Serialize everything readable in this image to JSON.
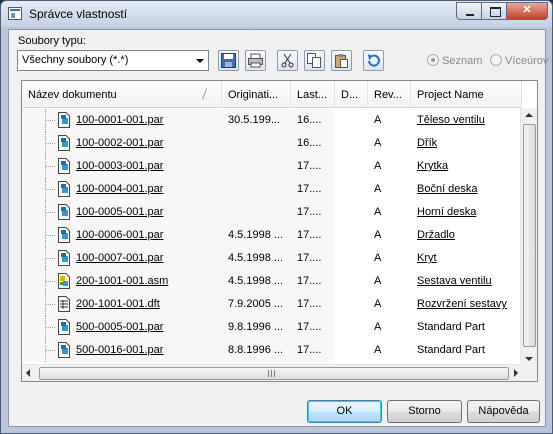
{
  "window": {
    "title": "Správce vlastností",
    "close_glyph": "✕"
  },
  "filter": {
    "label": "Soubory typu:",
    "value": "Všechny soubory (*.*)"
  },
  "toolbar": {
    "icons": [
      "save-icon",
      "print-icon",
      "cut-icon",
      "copy-icon",
      "paste-icon",
      "undo-icon"
    ]
  },
  "view": {
    "option_list": "Seznam",
    "option_multi": "Víceúrov",
    "selected": "Seznam"
  },
  "columns": [
    "Název dokumentu",
    "Originati...",
    "Last...",
    "D...",
    "Rev...",
    "Project Name"
  ],
  "rows": [
    {
      "icon": "part-file-icon",
      "name": "100-0001-001.par",
      "orig": "30.5.199...",
      "last": "16....",
      "d": "",
      "rev": "A",
      "project": "Těleso ventilu",
      "project_link": true
    },
    {
      "icon": "part-file-icon",
      "name": "100-0002-001.par",
      "orig": "",
      "last": "16....",
      "d": "",
      "rev": "A",
      "project": "Dřík",
      "project_link": true
    },
    {
      "icon": "part-file-icon",
      "name": "100-0003-001.par",
      "orig": "",
      "last": "17....",
      "d": "",
      "rev": "A",
      "project": "Krytka",
      "project_link": true
    },
    {
      "icon": "part-file-icon",
      "name": "100-0004-001.par",
      "orig": "",
      "last": "17....",
      "d": "",
      "rev": "A",
      "project": "Boční deska",
      "project_link": true
    },
    {
      "icon": "part-file-icon",
      "name": "100-0005-001.par",
      "orig": "",
      "last": "17....",
      "d": "",
      "rev": "A",
      "project": "Horní deska",
      "project_link": true
    },
    {
      "icon": "part-file-icon",
      "name": "100-0006-001.par",
      "orig": "4.5.1998 ...",
      "last": "17....",
      "d": "",
      "rev": "A",
      "project": "Držadlo",
      "project_link": true
    },
    {
      "icon": "part-file-icon",
      "name": "100-0007-001.par",
      "orig": "4.5.1998 ...",
      "last": "17....",
      "d": "",
      "rev": "A",
      "project": "Kryt",
      "project_link": true
    },
    {
      "icon": "assembly-file-icon",
      "name": "200-1001-001.asm",
      "orig": "4.5.1998 ...",
      "last": "17....",
      "d": "",
      "rev": "A",
      "project": "Sestava ventilu",
      "project_link": true
    },
    {
      "icon": "draft-file-icon",
      "name": "200-1001-001.dft",
      "orig": "7.9.2005 ...",
      "last": "17....",
      "d": "",
      "rev": "A",
      "project": "Rozvržení sestavy",
      "project_link": true
    },
    {
      "icon": "part-file-icon",
      "name": "500-0005-001.par",
      "orig": "9.8.1996 ...",
      "last": "17....",
      "d": "",
      "rev": "A",
      "project": "Standard Part",
      "project_link": false
    },
    {
      "icon": "part-file-icon",
      "name": "500-0016-001.par",
      "orig": "8.8.1996 ...",
      "last": "17....",
      "d": "",
      "rev": "A",
      "project": "Standard Part",
      "project_link": false
    }
  ],
  "buttons": {
    "ok": "OK",
    "cancel": "Storno",
    "help": "Nápověda"
  }
}
